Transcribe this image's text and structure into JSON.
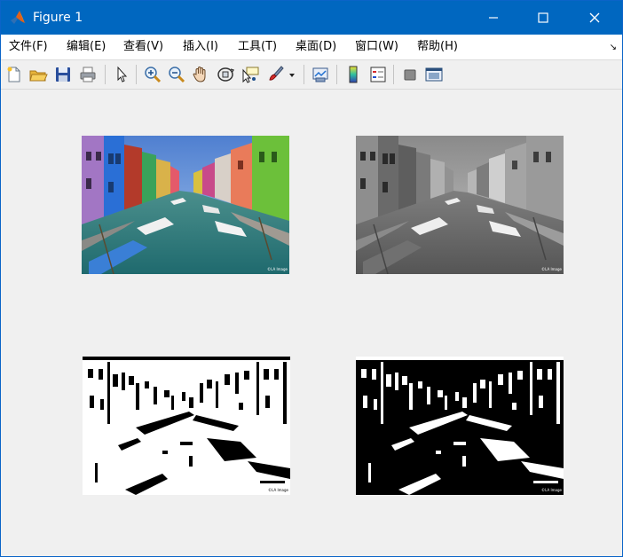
{
  "window": {
    "title": "Figure 1"
  },
  "menubar": {
    "items": [
      {
        "label": "文件(F)"
      },
      {
        "label": "编辑(E)"
      },
      {
        "label": "查看(V)"
      },
      {
        "label": "插入(I)"
      },
      {
        "label": "工具(T)"
      },
      {
        "label": "桌面(D)"
      },
      {
        "label": "窗口(W)"
      },
      {
        "label": "帮助(H)"
      }
    ]
  },
  "toolbar": {
    "icons": [
      "new-figure-icon",
      "open-file-icon",
      "save-icon",
      "print-icon",
      "edit-plot-icon",
      "zoom-in-icon",
      "zoom-out-icon",
      "pan-icon",
      "rotate-3d-icon",
      "data-cursor-icon",
      "brush-icon",
      "link-plot-icon",
      "colorbar-icon",
      "legend-icon",
      "hide-plot-tools-icon",
      "show-plot-tools-icon"
    ]
  },
  "figure": {
    "panels": [
      {
        "name": "color-image",
        "caption": ""
      },
      {
        "name": "grayscale-image",
        "caption": ""
      },
      {
        "name": "binary-image",
        "caption": ""
      },
      {
        "name": "inverted-binary-image",
        "caption": ""
      }
    ],
    "watermark": "©LA Image"
  },
  "colors": {
    "titlebar": "#0067c0",
    "canvas": "#f0f0f0"
  }
}
